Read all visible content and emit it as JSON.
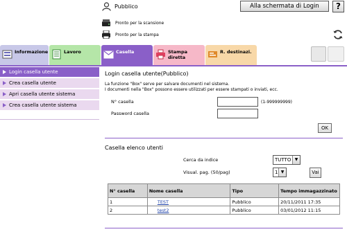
{
  "header": {
    "user": "Pubblico",
    "login_button": "Alla schermata di Login",
    "help_button": "?"
  },
  "status": {
    "scan": "Pronto per la scansione",
    "print": "Pronto per la stampa"
  },
  "tabs": [
    {
      "label": "Informazione"
    },
    {
      "label": "Lavoro"
    },
    {
      "label": "Casella"
    },
    {
      "label": "Stampa diretta"
    },
    {
      "label": "R. destinazi."
    }
  ],
  "sidebar": {
    "items": [
      {
        "label": "Login casella utente",
        "active": true
      },
      {
        "label": "Crea casella utente",
        "active": false
      },
      {
        "label": "Apri casella utente sistema",
        "active": false
      },
      {
        "label": "Crea casella utente sistema",
        "active": false
      }
    ]
  },
  "login": {
    "title": "Login casella utente(Pubblico)",
    "desc1": "La funzione \"Box\" serve per salvare documenti nel sistema.",
    "desc2": "I documenti nella \"Box\" possono essere utilizzati per essere stampati o inviati, ecc.",
    "box_number_label": "N° casella",
    "box_number_value": "",
    "box_number_range": "(1-999999999)",
    "password_label": "Password casella",
    "password_value": "",
    "ok_button": "OK"
  },
  "list": {
    "title": "Casella elenco utenti",
    "search_label": "Cerca da indice",
    "search_value": "TUTTO",
    "page_label": "Visual. pag. (50/pag)",
    "page_value": "1",
    "go_button": "Vai",
    "columns": [
      "N° casella",
      "Nome casella",
      "Tipo",
      "Tempo immagazzinato"
    ],
    "rows": [
      {
        "number": "1",
        "name": "TEST",
        "type": "Pubblico",
        "time": "20/11/2011 17:35"
      },
      {
        "number": "2",
        "name": "test2",
        "type": "Pubblico",
        "time": "03/01/2012 11:15"
      }
    ]
  },
  "colors": {
    "accent": "#8a5fc8",
    "sidebar_bg": "#ead9ef",
    "link": "#1a3ea8"
  },
  "icons": [
    "user-icon",
    "scanner-icon",
    "printer-icon",
    "refresh-icon",
    "info-icon",
    "job-icon",
    "box-icon",
    "direct-print-icon",
    "destination-icon"
  ]
}
